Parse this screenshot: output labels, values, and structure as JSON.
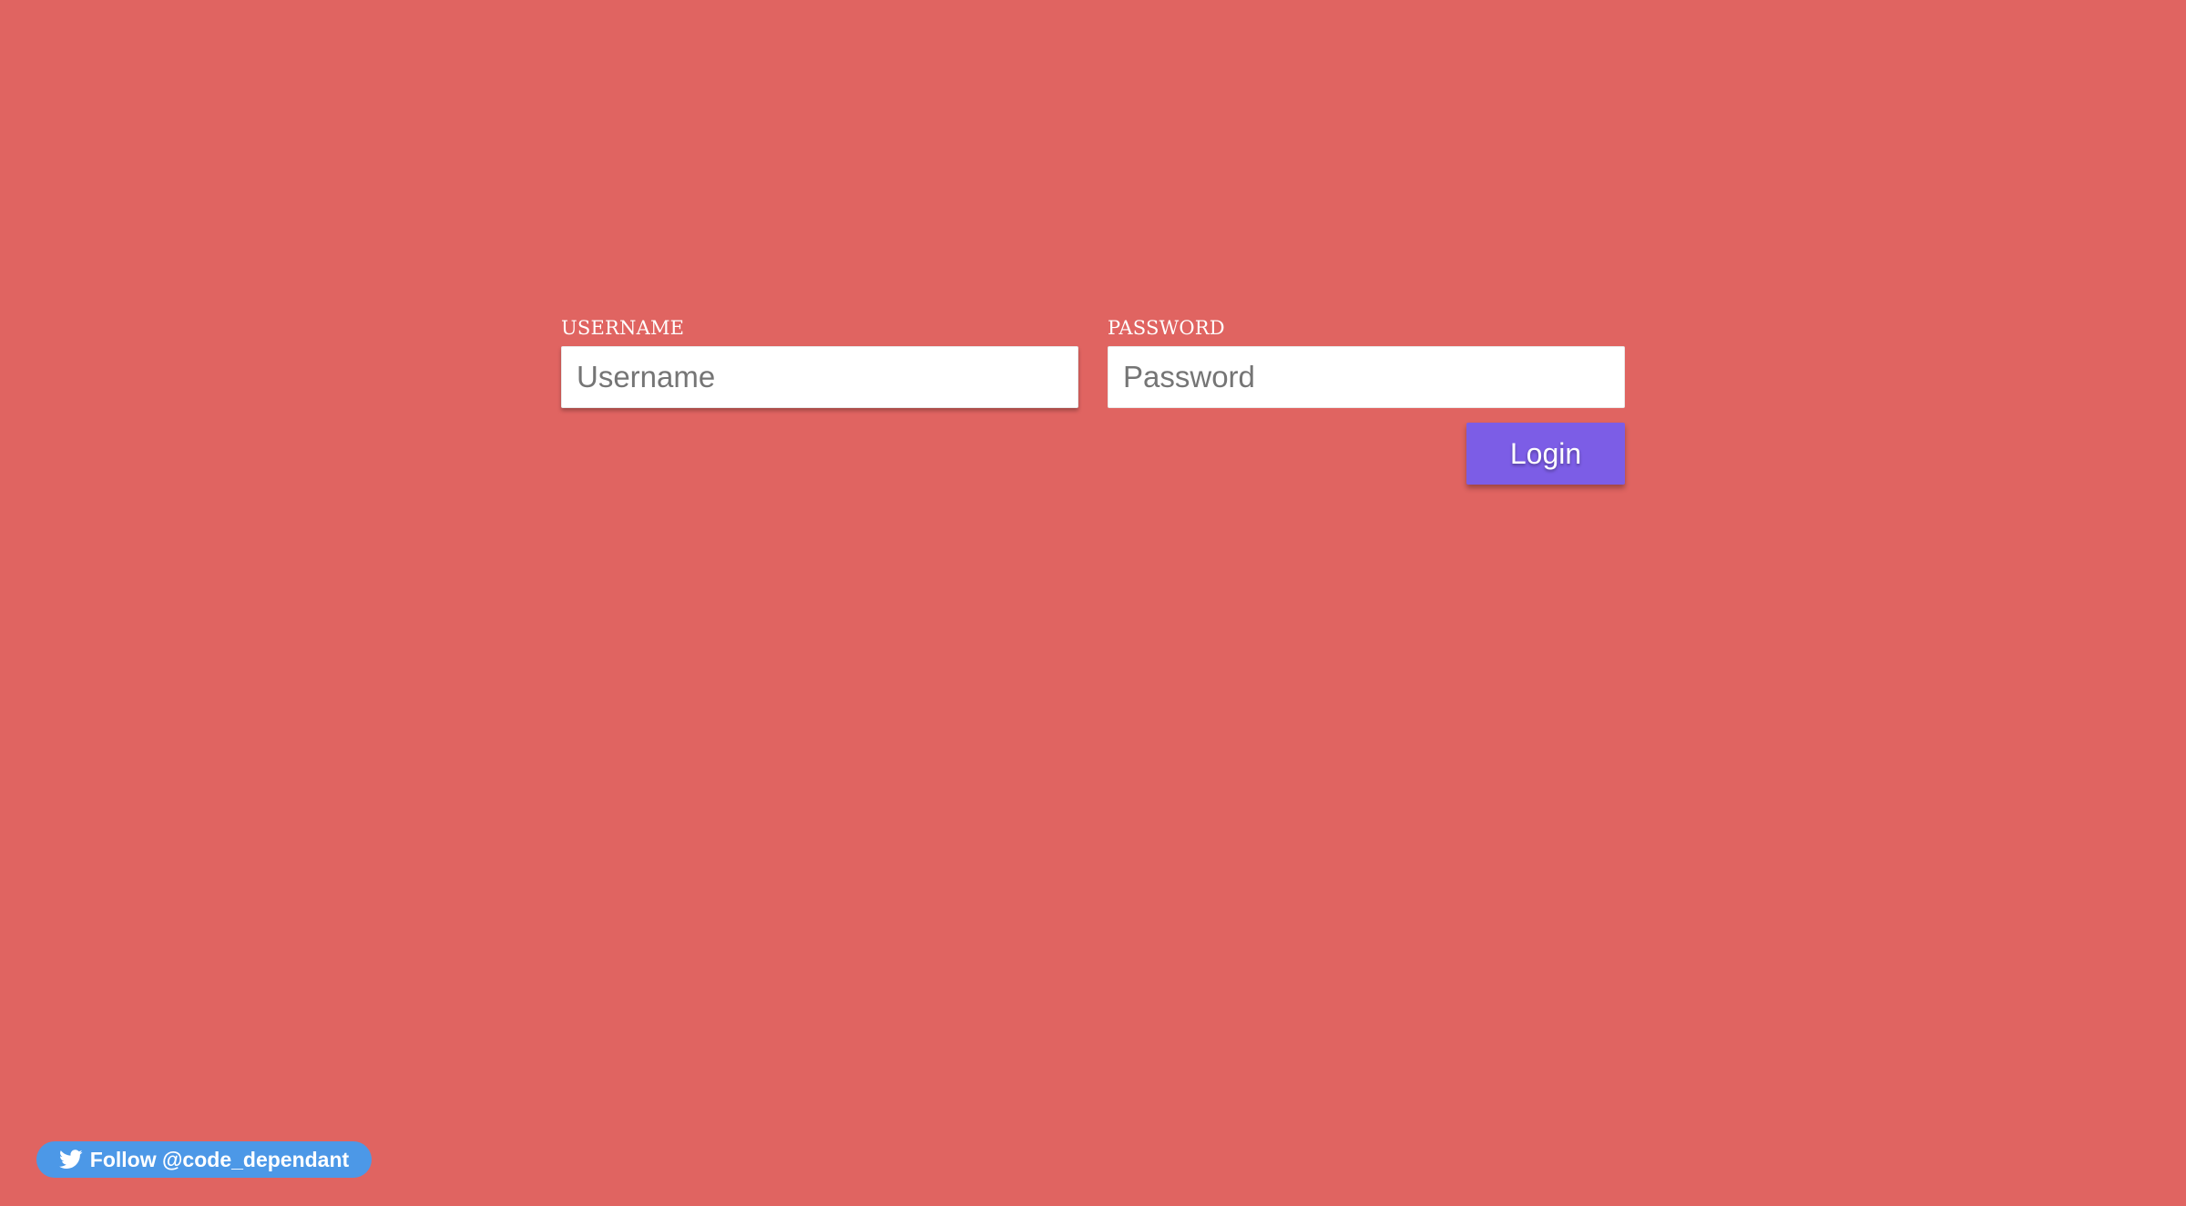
{
  "login": {
    "username_label": "USERNAME",
    "username_placeholder": "Username",
    "password_label": "PASSWORD",
    "password_placeholder": "Password",
    "submit_label": "Login"
  },
  "footer": {
    "twitter_follow_label": "Follow @code_dependant",
    "twitter_icon": "twitter-bird-icon"
  },
  "colors": {
    "background": "#e06461",
    "button": "#7c5de6",
    "twitter_button": "#4c98e7"
  }
}
